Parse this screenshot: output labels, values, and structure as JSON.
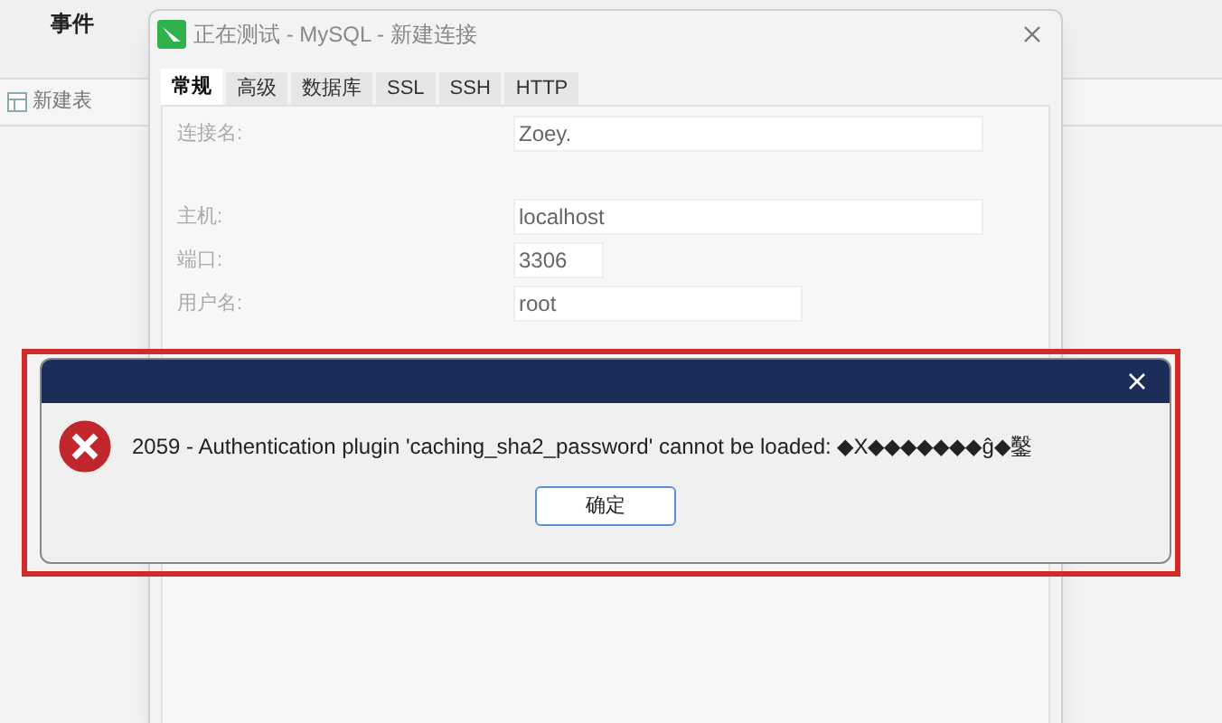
{
  "background_app": {
    "menu_item": "事件",
    "toolbar_button": "新建表"
  },
  "dialog": {
    "title": "正在测试 - MySQL - 新建连接",
    "tabs": [
      {
        "label": "常规",
        "selected": true
      },
      {
        "label": "高级",
        "selected": false
      },
      {
        "label": "数据库",
        "selected": false
      },
      {
        "label": "SSL",
        "selected": false
      },
      {
        "label": "SSH",
        "selected": false
      },
      {
        "label": "HTTP",
        "selected": false
      }
    ],
    "fields": [
      {
        "label": "连接名:",
        "value": "Zoey.",
        "kind": "wide"
      },
      {
        "label": "主机:",
        "value": "localhost",
        "kind": "wide"
      },
      {
        "label": "端口:",
        "value": "3306",
        "kind": "short"
      },
      {
        "label": "用户名:",
        "value": "root",
        "kind": "medium"
      }
    ]
  },
  "error": {
    "message": "2059 - Authentication plugin 'caching_sha2_password' cannot be loaded: ◆X◆◆◆◆◆◆◆ĝ◆鑿",
    "button": "确定"
  }
}
